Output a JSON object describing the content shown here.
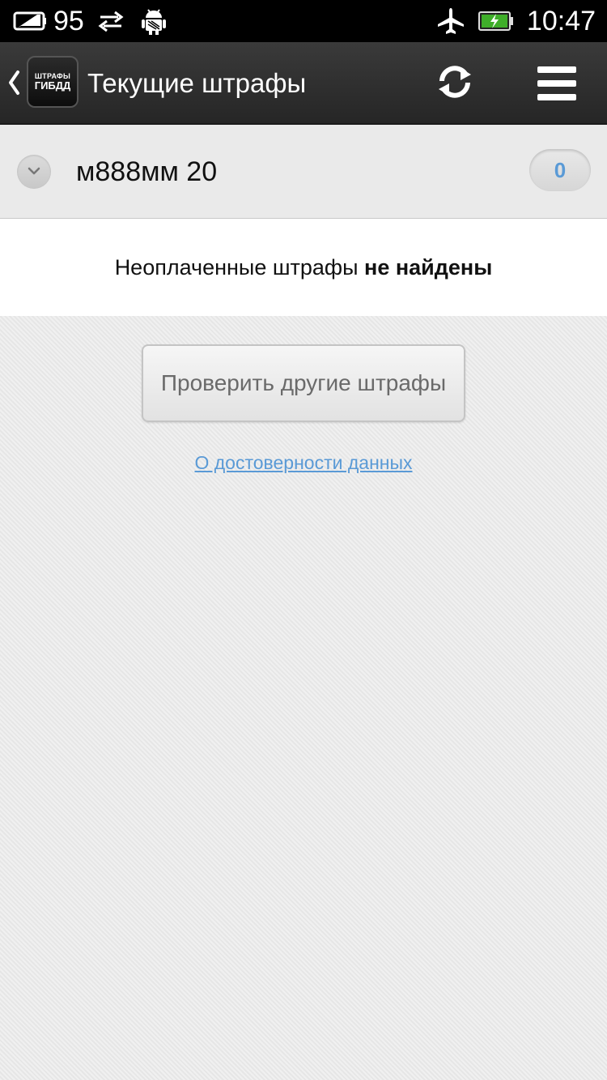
{
  "status_bar": {
    "battery_percent_text": "95",
    "time": "10:47",
    "icons": [
      "battery-level-icon",
      "sync-arrows-icon",
      "android-debug-icon",
      "airplane-mode-icon",
      "battery-charging-icon"
    ]
  },
  "action_bar": {
    "back_icon": "chevron-left-icon",
    "logo_line1": "ШТРАФЫ",
    "logo_line2": "ГИБДД",
    "title": "Текущие штрафы",
    "refresh_icon": "refresh-icon",
    "menu_icon": "menu-icon"
  },
  "vehicle": {
    "plate": "м888мм 20",
    "fines_count": "0"
  },
  "message": {
    "prefix": "Неоплаченные штрафы ",
    "emphasis": "не найдены"
  },
  "actions": {
    "check_other_label": "Проверить другие штрафы",
    "about_link": "О достоверности данных"
  },
  "colors": {
    "accent_blue": "#5a9ad6",
    "action_bar": "#2e2e2e",
    "background": "#ebebeb"
  }
}
